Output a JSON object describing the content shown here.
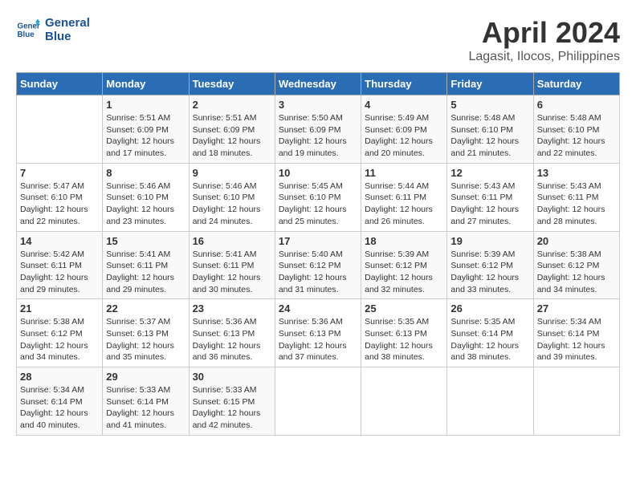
{
  "logo": {
    "line1": "General",
    "line2": "Blue"
  },
  "title": "April 2024",
  "subtitle": "Lagasit, Ilocos, Philippines",
  "weekdays": [
    "Sunday",
    "Monday",
    "Tuesday",
    "Wednesday",
    "Thursday",
    "Friday",
    "Saturday"
  ],
  "weeks": [
    [
      {
        "day": "",
        "info": ""
      },
      {
        "day": "1",
        "info": "Sunrise: 5:51 AM\nSunset: 6:09 PM\nDaylight: 12 hours\nand 17 minutes."
      },
      {
        "day": "2",
        "info": "Sunrise: 5:51 AM\nSunset: 6:09 PM\nDaylight: 12 hours\nand 18 minutes."
      },
      {
        "day": "3",
        "info": "Sunrise: 5:50 AM\nSunset: 6:09 PM\nDaylight: 12 hours\nand 19 minutes."
      },
      {
        "day": "4",
        "info": "Sunrise: 5:49 AM\nSunset: 6:09 PM\nDaylight: 12 hours\nand 20 minutes."
      },
      {
        "day": "5",
        "info": "Sunrise: 5:48 AM\nSunset: 6:10 PM\nDaylight: 12 hours\nand 21 minutes."
      },
      {
        "day": "6",
        "info": "Sunrise: 5:48 AM\nSunset: 6:10 PM\nDaylight: 12 hours\nand 22 minutes."
      }
    ],
    [
      {
        "day": "7",
        "info": "Sunrise: 5:47 AM\nSunset: 6:10 PM\nDaylight: 12 hours\nand 22 minutes."
      },
      {
        "day": "8",
        "info": "Sunrise: 5:46 AM\nSunset: 6:10 PM\nDaylight: 12 hours\nand 23 minutes."
      },
      {
        "day": "9",
        "info": "Sunrise: 5:46 AM\nSunset: 6:10 PM\nDaylight: 12 hours\nand 24 minutes."
      },
      {
        "day": "10",
        "info": "Sunrise: 5:45 AM\nSunset: 6:10 PM\nDaylight: 12 hours\nand 25 minutes."
      },
      {
        "day": "11",
        "info": "Sunrise: 5:44 AM\nSunset: 6:11 PM\nDaylight: 12 hours\nand 26 minutes."
      },
      {
        "day": "12",
        "info": "Sunrise: 5:43 AM\nSunset: 6:11 PM\nDaylight: 12 hours\nand 27 minutes."
      },
      {
        "day": "13",
        "info": "Sunrise: 5:43 AM\nSunset: 6:11 PM\nDaylight: 12 hours\nand 28 minutes."
      }
    ],
    [
      {
        "day": "14",
        "info": "Sunrise: 5:42 AM\nSunset: 6:11 PM\nDaylight: 12 hours\nand 29 minutes."
      },
      {
        "day": "15",
        "info": "Sunrise: 5:41 AM\nSunset: 6:11 PM\nDaylight: 12 hours\nand 29 minutes."
      },
      {
        "day": "16",
        "info": "Sunrise: 5:41 AM\nSunset: 6:11 PM\nDaylight: 12 hours\nand 30 minutes."
      },
      {
        "day": "17",
        "info": "Sunrise: 5:40 AM\nSunset: 6:12 PM\nDaylight: 12 hours\nand 31 minutes."
      },
      {
        "day": "18",
        "info": "Sunrise: 5:39 AM\nSunset: 6:12 PM\nDaylight: 12 hours\nand 32 minutes."
      },
      {
        "day": "19",
        "info": "Sunrise: 5:39 AM\nSunset: 6:12 PM\nDaylight: 12 hours\nand 33 minutes."
      },
      {
        "day": "20",
        "info": "Sunrise: 5:38 AM\nSunset: 6:12 PM\nDaylight: 12 hours\nand 34 minutes."
      }
    ],
    [
      {
        "day": "21",
        "info": "Sunrise: 5:38 AM\nSunset: 6:12 PM\nDaylight: 12 hours\nand 34 minutes."
      },
      {
        "day": "22",
        "info": "Sunrise: 5:37 AM\nSunset: 6:13 PM\nDaylight: 12 hours\nand 35 minutes."
      },
      {
        "day": "23",
        "info": "Sunrise: 5:36 AM\nSunset: 6:13 PM\nDaylight: 12 hours\nand 36 minutes."
      },
      {
        "day": "24",
        "info": "Sunrise: 5:36 AM\nSunset: 6:13 PM\nDaylight: 12 hours\nand 37 minutes."
      },
      {
        "day": "25",
        "info": "Sunrise: 5:35 AM\nSunset: 6:13 PM\nDaylight: 12 hours\nand 38 minutes."
      },
      {
        "day": "26",
        "info": "Sunrise: 5:35 AM\nSunset: 6:14 PM\nDaylight: 12 hours\nand 38 minutes."
      },
      {
        "day": "27",
        "info": "Sunrise: 5:34 AM\nSunset: 6:14 PM\nDaylight: 12 hours\nand 39 minutes."
      }
    ],
    [
      {
        "day": "28",
        "info": "Sunrise: 5:34 AM\nSunset: 6:14 PM\nDaylight: 12 hours\nand 40 minutes."
      },
      {
        "day": "29",
        "info": "Sunrise: 5:33 AM\nSunset: 6:14 PM\nDaylight: 12 hours\nand 41 minutes."
      },
      {
        "day": "30",
        "info": "Sunrise: 5:33 AM\nSunset: 6:15 PM\nDaylight: 12 hours\nand 42 minutes."
      },
      {
        "day": "",
        "info": ""
      },
      {
        "day": "",
        "info": ""
      },
      {
        "day": "",
        "info": ""
      },
      {
        "day": "",
        "info": ""
      }
    ]
  ]
}
